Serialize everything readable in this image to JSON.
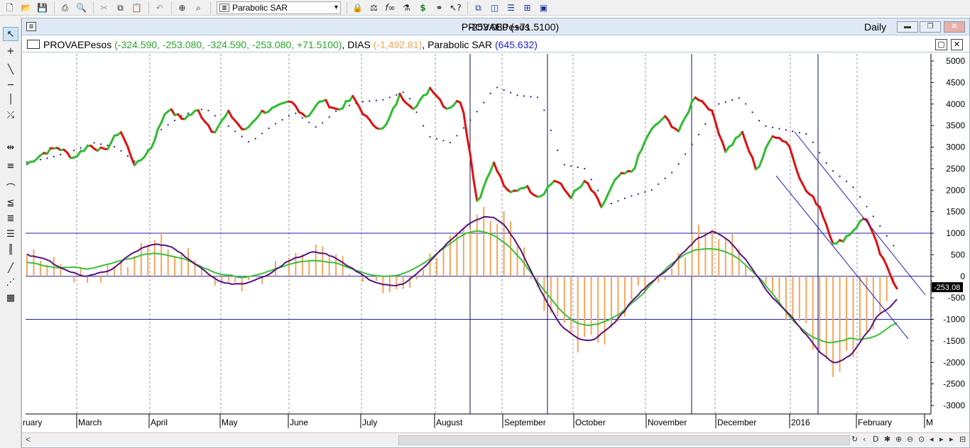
{
  "toolbar": {
    "study_select": "Parabolic SAR",
    "icons": [
      "new-icon",
      "open-icon",
      "save-icon",
      "print-icon",
      "print-preview-icon",
      "cut-icon",
      "copy-icon",
      "paste-icon",
      "undo-icon",
      "crosshair-icon",
      "zoom-icon",
      "study-icon",
      "indicator-icon",
      "formula-icon",
      "chart-analysis-icon",
      "dollar-icon",
      "binoculars-icon",
      "help-cursor-icon",
      "cascade-icon",
      "tile-vertical-icon",
      "tile-horizontal-icon",
      "arrange-icon",
      "wizard-icon"
    ]
  },
  "window": {
    "title": "PROVAEPesos",
    "title_overlay": "-253.080 (+71.5100)",
    "period": "Daily"
  },
  "legend": {
    "symbol": "PROVAEPesos",
    "ohlc": "(-324.590, -253.080, -324.590, -253.080, +71.5100)",
    "indicator1": "DIAS",
    "indicator1_value": "(-1,492.81)",
    "indicator2": "Parabolic SAR",
    "indicator2_value": "(645.632)",
    "comma": ","
  },
  "axis": {
    "y_ticks": [
      "5000",
      "4500",
      "4000",
      "3500",
      "3000",
      "2500",
      "2000",
      "1500",
      "1000",
      "500",
      "0",
      "-500",
      "-1000",
      "-1500",
      "-2000",
      "-2500",
      "-3000"
    ],
    "last_value_label": "-253.08",
    "months": [
      "February",
      "March",
      "April",
      "May",
      "June",
      "July",
      "August",
      "September",
      "October",
      "November",
      "December",
      "2016",
      "February"
    ],
    "months_visible": [
      "ruary",
      "March",
      "April",
      "May",
      "June",
      "July",
      "August",
      "September",
      "October",
      "November",
      "December",
      "2016",
      "February",
      "M"
    ]
  },
  "colors": {
    "price_up": "#2ebd2e",
    "price_down": "#e01010",
    "sar": "#1a1a8c",
    "hist": "#f5a55a",
    "osc_purple": "#5a1080",
    "osc_green": "#39c039",
    "hline": "#2020a0",
    "vline": "#101060",
    "trendline": "#1a1acc"
  },
  "chart_data": {
    "type": "line",
    "ylim": [
      -3200,
      5200
    ],
    "x": [
      "Feb",
      "Mar",
      "Apr",
      "May",
      "Jun",
      "Jul",
      "Aug",
      "Sep",
      "Oct",
      "Nov",
      "Dec",
      "Jan 2016",
      "Feb 2016"
    ],
    "horizontal_lines": [
      1000,
      0,
      -1000
    ],
    "series": [
      {
        "values": [
          2600,
          2850,
          3000,
          2750,
          3050,
          2900,
          3400,
          2550,
          3000,
          3900,
          3650,
          3850,
          3350,
          3800,
          3350,
          3800,
          3900,
          4050,
          3700,
          4100,
          3850,
          4150,
          3600,
          3400,
          4200,
          3900,
          4400,
          3900,
          4100,
          1700,
          2650,
          1900,
          2100,
          1850,
          2250,
          1850,
          2200,
          1600,
          2300,
          2450,
          3300,
          3700,
          3350,
          4200,
          3900,
          2900,
          3350,
          2450,
          3300,
          3100,
          2050,
          1650,
          700,
          1000,
          1400,
          450,
          -250
        ]
      },
      {
        "values": [
          2650,
          2750,
          2900,
          3100,
          3000,
          2600,
          3400,
          3750,
          3900,
          3500,
          3100,
          3500,
          3800,
          3450,
          3900,
          4050,
          4100,
          4300,
          3250,
          3100,
          3700,
          4400,
          4200,
          4150,
          2600,
          2500,
          1650,
          1850,
          2000,
          2450,
          3200,
          4000,
          4150,
          3500,
          3400,
          3300,
          2500,
          2100,
          1350,
          600
        ]
      },
      {
        "values": [
          700,
          150,
          -100,
          350,
          900,
          500,
          -200,
          -50,
          200,
          700,
          300,
          -200,
          -50,
          700,
          1500,
          1350,
          -500,
          -1700,
          -1400,
          -200,
          100,
          1300,
          900,
          -500,
          -1100,
          -2300,
          -1500,
          -200
        ]
      },
      {
        "values": [
          550,
          320,
          120,
          80,
          700,
          450,
          40,
          150,
          450,
          300,
          -40,
          -100,
          250,
          450,
          -700,
          -1450,
          -900,
          -200,
          900,
          1050,
          700,
          -400,
          -1100,
          -1600,
          -1650
        ]
      },
      {
        "values": [
          500,
          1000,
          1500,
          -100,
          1200,
          900,
          -300,
          1000,
          1400,
          -2400,
          -1800,
          -600,
          1700,
          1100,
          -1400,
          -1000,
          -2200,
          -1800
        ]
      }
    ]
  }
}
